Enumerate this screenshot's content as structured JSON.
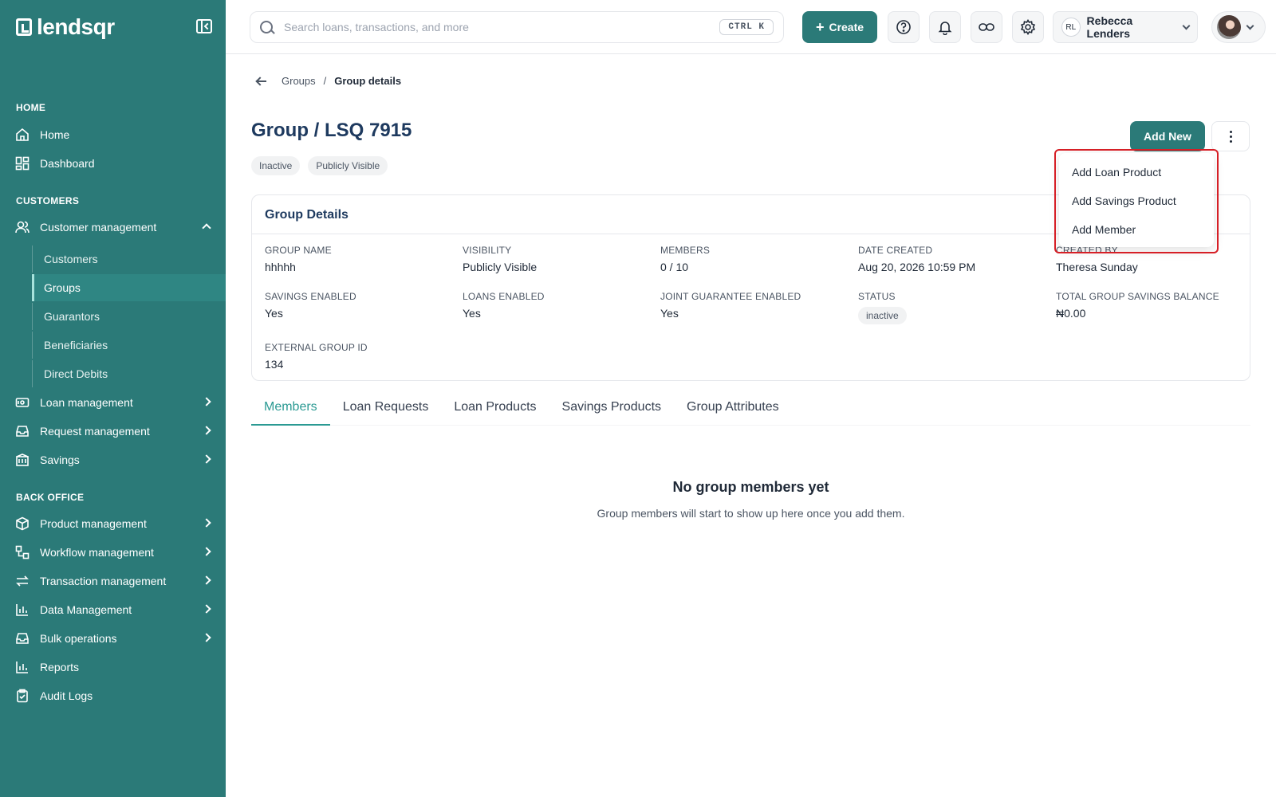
{
  "brand": {
    "name": "lendsqr"
  },
  "sidebar": {
    "sections": {
      "home": "HOME",
      "customers": "CUSTOMERS",
      "back_office": "BACK OFFICE"
    },
    "home_items": [
      "Home",
      "Dashboard"
    ],
    "customer_management": {
      "label": "Customer management",
      "children": [
        "Customers",
        "Groups",
        "Guarantors",
        "Beneficiaries",
        "Direct Debits"
      ],
      "active_child": "Groups"
    },
    "customer_items": [
      "Loan management",
      "Request management",
      "Savings"
    ],
    "back_office_items": [
      "Product management",
      "Workflow management",
      "Transaction management",
      "Data Management",
      "Bulk operations",
      "Reports",
      "Audit Logs"
    ]
  },
  "topbar": {
    "search_placeholder": "Search loans, transactions, and more",
    "shortcut": "CTRL K",
    "create_label": "Create",
    "user": {
      "initials": "RL",
      "name": "Rebecca Lenders"
    }
  },
  "breadcrumb": {
    "parent": "Groups",
    "separator": "/",
    "current": "Group details"
  },
  "page": {
    "title": "Group / LSQ 7915",
    "chips": [
      "Inactive",
      "Publicly Visible"
    ],
    "add_new_label": "Add New"
  },
  "dropdown": {
    "items": [
      "Add Loan Product",
      "Add Savings Product",
      "Add Member"
    ]
  },
  "details": {
    "title": "Group Details",
    "fields": [
      {
        "label": "GROUP NAME",
        "value": "hhhhh"
      },
      {
        "label": "VISIBILITY",
        "value": "Publicly Visible"
      },
      {
        "label": "MEMBERS",
        "value": "0 / 10"
      },
      {
        "label": "DATE CREATED",
        "value": "Aug 20, 2026 10:59 PM"
      },
      {
        "label": "CREATED BY",
        "value": "Theresa Sunday"
      },
      {
        "label": "SAVINGS ENABLED",
        "value": "Yes"
      },
      {
        "label": "LOANS ENABLED",
        "value": "Yes"
      },
      {
        "label": "JOINT GUARANTEE ENABLED",
        "value": "Yes"
      },
      {
        "label": "STATUS",
        "value": "inactive"
      },
      {
        "label": "TOTAL GROUP SAVINGS BALANCE",
        "value": "₦0.00"
      },
      {
        "label": "EXTERNAL GROUP ID",
        "value": "134"
      }
    ]
  },
  "tabs": [
    "Members",
    "Loan Requests",
    "Loan Products",
    "Savings Products",
    "Group Attributes"
  ],
  "active_tab": "Members",
  "empty_state": {
    "title": "No group members yet",
    "subtitle": "Group members will start to show up here once you add them."
  },
  "colors": {
    "sidebar": "#2b7a78",
    "accent": "#2b9a93",
    "title": "#1e3a5f",
    "highlight": "#d61f26"
  }
}
